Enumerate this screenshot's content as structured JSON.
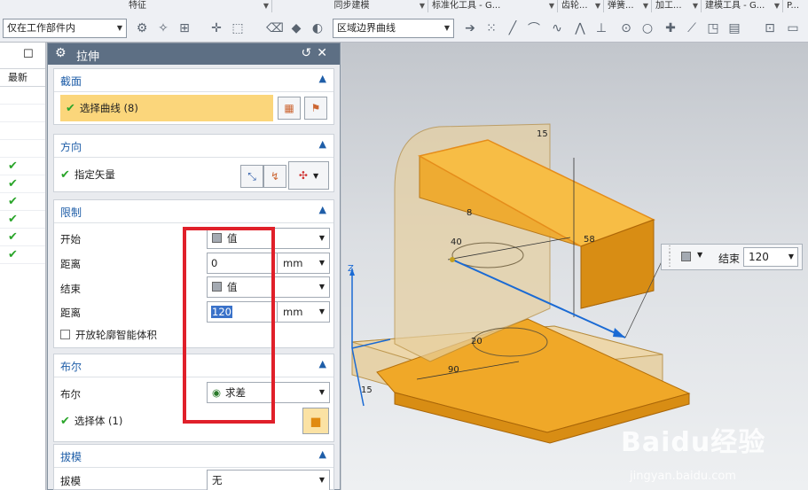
{
  "toolbar": {
    "groups": [
      "特征",
      "同步建模",
      "标准化工具 - G...",
      "齿轮...",
      "弹簧...",
      "加工...",
      "建模工具 - G...",
      "P..."
    ],
    "filter_combo": "仅在工作部件内",
    "curve_rule_combo": "区域边界曲线"
  },
  "left_panel": {
    "column_header": "最新",
    "checks": 6
  },
  "dialog": {
    "title": "拉伸",
    "section": {
      "label": "截面",
      "select_curve": "选择曲线 (8)"
    },
    "direction": {
      "label": "方向",
      "specify_vector": "指定矢量"
    },
    "limits": {
      "label": "限制",
      "start_label": "开始",
      "start_value": "值",
      "distance_label": "距离",
      "distance_start": "0",
      "unit": "mm",
      "end_label": "结束",
      "end_value": "值",
      "distance_end": "120",
      "open_profile": "开放轮廓智能体积"
    },
    "boolean": {
      "label": "布尔",
      "bool_label": "布尔",
      "bool_value": "求差",
      "select_body": "选择体 (1)"
    },
    "draft": {
      "label": "拔模",
      "draft_label": "拔模",
      "draft_value": "无"
    }
  },
  "viewport": {
    "hud": {
      "end_label": "结束",
      "end_value": "120"
    },
    "dimensions": [
      "15",
      "8",
      "40",
      "58",
      "20",
      "90",
      "15"
    ],
    "axis_z": "Z"
  },
  "watermark": {
    "brand": "Baidu经验",
    "url": "jingyan.baidu.com"
  },
  "colors": {
    "dialog_title": "#5d6f84",
    "section_label": "#1f5ea8",
    "selection": "#fbd67b",
    "annotation": "#e0202a",
    "model_fill": "#f0a828",
    "model_frame": "#d9b36a"
  }
}
